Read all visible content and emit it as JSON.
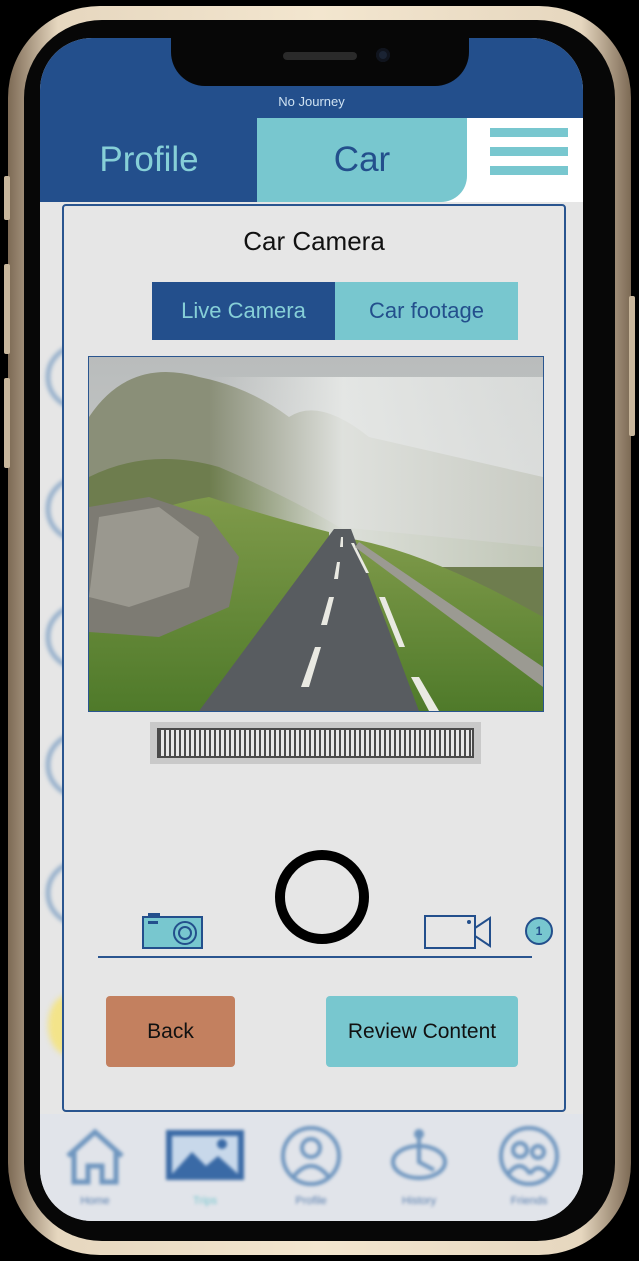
{
  "status": {
    "journey_text": "No Journey"
  },
  "tabs": {
    "profile_label": "Profile",
    "car_label": "Car",
    "menu_icon": "hamburger-menu-icon"
  },
  "modal": {
    "title": "Car Camera",
    "segments": {
      "live_label": "Live Camera",
      "footage_label": "Car footage",
      "selected": "Live Camera"
    },
    "photo_description_icon": "road-landscape-image",
    "capture_modes": {
      "photo_icon": "camera-icon",
      "video_icon": "video-camera-icon",
      "count": "1"
    },
    "buttons": {
      "back_label": "Back",
      "review_label": "Review Content"
    }
  },
  "bottom_nav": {
    "items": [
      {
        "label": "Home",
        "icon": "home-icon"
      },
      {
        "label": "Trips",
        "icon": "image-icon"
      },
      {
        "label": "Profile",
        "icon": "profile-icon"
      },
      {
        "label": "History",
        "icon": "history-icon"
      },
      {
        "label": "Friends",
        "icon": "friends-icon"
      }
    ]
  },
  "colors": {
    "primary": "#234f8c",
    "accent": "#78c7cf",
    "back_button": "#c3805f",
    "modal_bg": "#e6e6e6"
  }
}
